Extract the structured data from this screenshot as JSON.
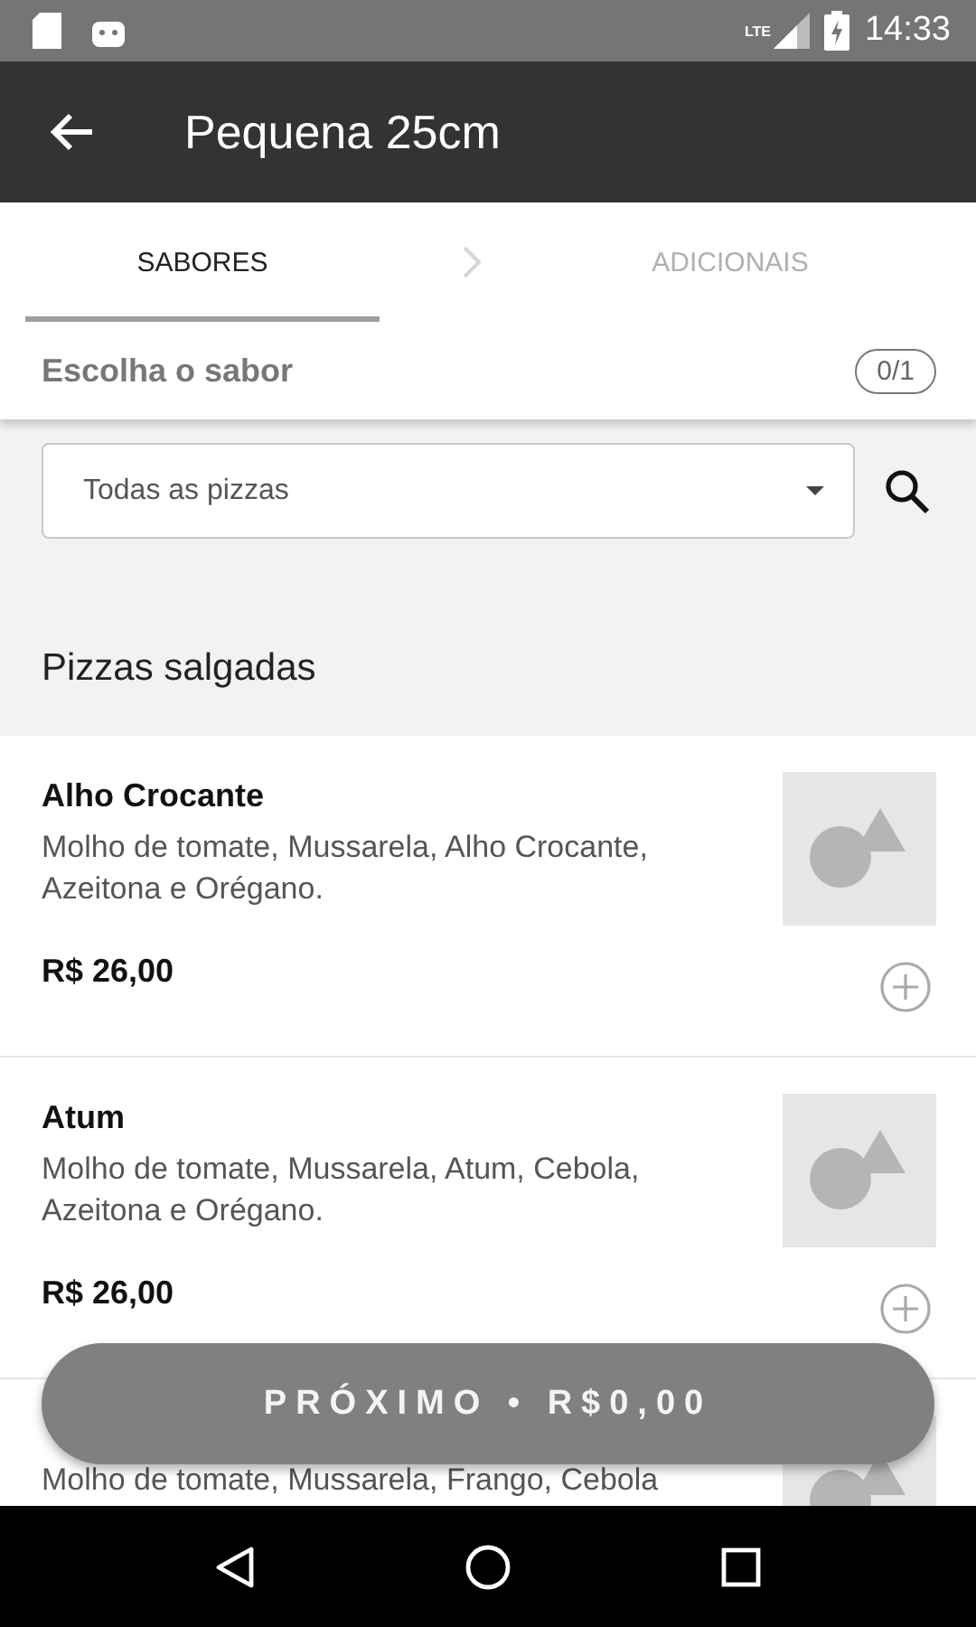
{
  "status_bar": {
    "time": "14:33",
    "network": "LTE"
  },
  "app_bar": {
    "title": "Pequena 25cm"
  },
  "steps": [
    {
      "label": "SABORES",
      "selected": true
    },
    {
      "label": "ADICIONAIS",
      "selected": false
    }
  ],
  "header": {
    "label": "Escolha o sabor",
    "counter": "0/1"
  },
  "filter": {
    "value": "Todas as pizzas"
  },
  "section": {
    "title": "Pizzas salgadas"
  },
  "items": [
    {
      "name": "Alho Crocante",
      "description": "Molho de tomate, Mussarela, Alho Crocante, Azeitona e Orégano.",
      "price": "R$ 26,00"
    },
    {
      "name": "Atum",
      "description": "Molho de tomate, Mussarela, Atum, Cebola, Azeitona e Orégano.",
      "price": "R$ 26,00"
    },
    {
      "description": "Molho de tomate, Mussarela, Frango, Cebola"
    }
  ],
  "next_button": {
    "label": "PRÓXIMO • R$0,00",
    "disabled": true
  }
}
